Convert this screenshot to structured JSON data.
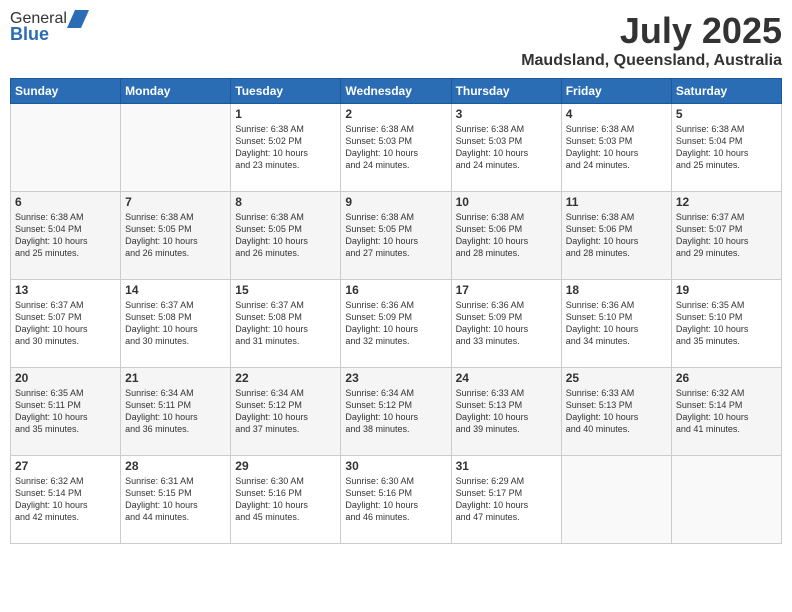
{
  "header": {
    "logo_general": "General",
    "logo_blue": "Blue",
    "month_year": "July 2025",
    "location": "Maudsland, Queensland, Australia"
  },
  "days_of_week": [
    "Sunday",
    "Monday",
    "Tuesday",
    "Wednesday",
    "Thursday",
    "Friday",
    "Saturday"
  ],
  "weeks": [
    [
      {
        "day": "",
        "content": ""
      },
      {
        "day": "",
        "content": ""
      },
      {
        "day": "1",
        "content": "Sunrise: 6:38 AM\nSunset: 5:02 PM\nDaylight: 10 hours\nand 23 minutes."
      },
      {
        "day": "2",
        "content": "Sunrise: 6:38 AM\nSunset: 5:03 PM\nDaylight: 10 hours\nand 24 minutes."
      },
      {
        "day": "3",
        "content": "Sunrise: 6:38 AM\nSunset: 5:03 PM\nDaylight: 10 hours\nand 24 minutes."
      },
      {
        "day": "4",
        "content": "Sunrise: 6:38 AM\nSunset: 5:03 PM\nDaylight: 10 hours\nand 24 minutes."
      },
      {
        "day": "5",
        "content": "Sunrise: 6:38 AM\nSunset: 5:04 PM\nDaylight: 10 hours\nand 25 minutes."
      }
    ],
    [
      {
        "day": "6",
        "content": "Sunrise: 6:38 AM\nSunset: 5:04 PM\nDaylight: 10 hours\nand 25 minutes."
      },
      {
        "day": "7",
        "content": "Sunrise: 6:38 AM\nSunset: 5:05 PM\nDaylight: 10 hours\nand 26 minutes."
      },
      {
        "day": "8",
        "content": "Sunrise: 6:38 AM\nSunset: 5:05 PM\nDaylight: 10 hours\nand 26 minutes."
      },
      {
        "day": "9",
        "content": "Sunrise: 6:38 AM\nSunset: 5:05 PM\nDaylight: 10 hours\nand 27 minutes."
      },
      {
        "day": "10",
        "content": "Sunrise: 6:38 AM\nSunset: 5:06 PM\nDaylight: 10 hours\nand 28 minutes."
      },
      {
        "day": "11",
        "content": "Sunrise: 6:38 AM\nSunset: 5:06 PM\nDaylight: 10 hours\nand 28 minutes."
      },
      {
        "day": "12",
        "content": "Sunrise: 6:37 AM\nSunset: 5:07 PM\nDaylight: 10 hours\nand 29 minutes."
      }
    ],
    [
      {
        "day": "13",
        "content": "Sunrise: 6:37 AM\nSunset: 5:07 PM\nDaylight: 10 hours\nand 30 minutes."
      },
      {
        "day": "14",
        "content": "Sunrise: 6:37 AM\nSunset: 5:08 PM\nDaylight: 10 hours\nand 30 minutes."
      },
      {
        "day": "15",
        "content": "Sunrise: 6:37 AM\nSunset: 5:08 PM\nDaylight: 10 hours\nand 31 minutes."
      },
      {
        "day": "16",
        "content": "Sunrise: 6:36 AM\nSunset: 5:09 PM\nDaylight: 10 hours\nand 32 minutes."
      },
      {
        "day": "17",
        "content": "Sunrise: 6:36 AM\nSunset: 5:09 PM\nDaylight: 10 hours\nand 33 minutes."
      },
      {
        "day": "18",
        "content": "Sunrise: 6:36 AM\nSunset: 5:10 PM\nDaylight: 10 hours\nand 34 minutes."
      },
      {
        "day": "19",
        "content": "Sunrise: 6:35 AM\nSunset: 5:10 PM\nDaylight: 10 hours\nand 35 minutes."
      }
    ],
    [
      {
        "day": "20",
        "content": "Sunrise: 6:35 AM\nSunset: 5:11 PM\nDaylight: 10 hours\nand 35 minutes."
      },
      {
        "day": "21",
        "content": "Sunrise: 6:34 AM\nSunset: 5:11 PM\nDaylight: 10 hours\nand 36 minutes."
      },
      {
        "day": "22",
        "content": "Sunrise: 6:34 AM\nSunset: 5:12 PM\nDaylight: 10 hours\nand 37 minutes."
      },
      {
        "day": "23",
        "content": "Sunrise: 6:34 AM\nSunset: 5:12 PM\nDaylight: 10 hours\nand 38 minutes."
      },
      {
        "day": "24",
        "content": "Sunrise: 6:33 AM\nSunset: 5:13 PM\nDaylight: 10 hours\nand 39 minutes."
      },
      {
        "day": "25",
        "content": "Sunrise: 6:33 AM\nSunset: 5:13 PM\nDaylight: 10 hours\nand 40 minutes."
      },
      {
        "day": "26",
        "content": "Sunrise: 6:32 AM\nSunset: 5:14 PM\nDaylight: 10 hours\nand 41 minutes."
      }
    ],
    [
      {
        "day": "27",
        "content": "Sunrise: 6:32 AM\nSunset: 5:14 PM\nDaylight: 10 hours\nand 42 minutes."
      },
      {
        "day": "28",
        "content": "Sunrise: 6:31 AM\nSunset: 5:15 PM\nDaylight: 10 hours\nand 44 minutes."
      },
      {
        "day": "29",
        "content": "Sunrise: 6:30 AM\nSunset: 5:16 PM\nDaylight: 10 hours\nand 45 minutes."
      },
      {
        "day": "30",
        "content": "Sunrise: 6:30 AM\nSunset: 5:16 PM\nDaylight: 10 hours\nand 46 minutes."
      },
      {
        "day": "31",
        "content": "Sunrise: 6:29 AM\nSunset: 5:17 PM\nDaylight: 10 hours\nand 47 minutes."
      },
      {
        "day": "",
        "content": ""
      },
      {
        "day": "",
        "content": ""
      }
    ]
  ]
}
